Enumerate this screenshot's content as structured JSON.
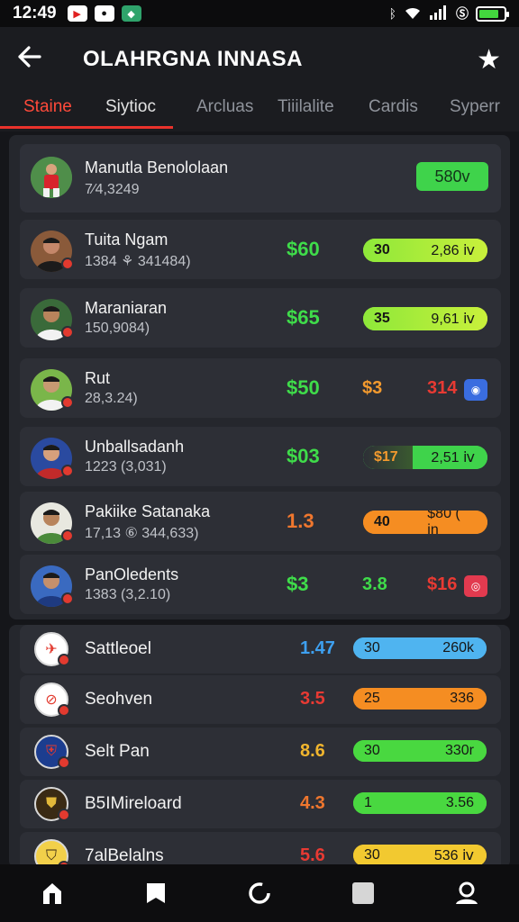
{
  "status_bar": {
    "time": "12:49",
    "apps": [
      "youtube-icon",
      "chat-icon",
      "gallery-icon"
    ],
    "battery_level": 0.8,
    "icons": [
      "bluetooth-icon",
      "wifi-icon",
      "signal-icon",
      "nfc-icon",
      "battery-icon"
    ]
  },
  "header": {
    "title": "OLAHRGNA INNASA",
    "back_icon": "back-arrow-icon",
    "favorite_icon": "star-icon"
  },
  "tabs": [
    {
      "label": "Staine",
      "active": true
    },
    {
      "label": "Siytioc",
      "active": false
    },
    {
      "label": "Arcluas",
      "active": false
    },
    {
      "label": "Tiiilalite",
      "active": false
    },
    {
      "label": "Cardis",
      "active": false
    },
    {
      "label": "Syperr",
      "active": false
    }
  ],
  "featured": {
    "name": "Manutla Benololaan",
    "stats": "7⁄4,3249",
    "button": "580v",
    "button_color": "#3fd34b"
  },
  "players": [
    {
      "name": "Tuita Ngam",
      "stats": "1384 ⚘ 341484)",
      "price": "$60",
      "price_color": "#3fdc4a",
      "pill_left": "30",
      "pill_right": "2,86 ⅳ",
      "pill_fill": 1.0,
      "pill_colors": [
        "#8ee83a",
        "#c9f03b"
      ]
    },
    {
      "name": "Maraniaran",
      "stats": "150,9084)",
      "price": "$65",
      "price_color": "#3fdc4a",
      "pill_left": "35",
      "pill_right": "9,61 ⅳ",
      "pill_fill": 1.0,
      "pill_colors": [
        "#8ee83a",
        "#c9f03b"
      ]
    },
    {
      "name": "Rut",
      "stats": "28,3.24)",
      "price": "$50",
      "price_color": "#3fdc4a",
      "plain_value": "$3",
      "plain_color": "#f39a2e",
      "plain_red": "314",
      "icon": "info-icon",
      "icon_color": "#3a6de0"
    },
    {
      "name": "Unballsadanh",
      "stats": "1223 (3,031)",
      "price": "$03",
      "price_color": "#3fdc4a",
      "pill_left": "$17",
      "pill_right": "2,51 ⅳ",
      "pill_fill": 1.0,
      "pill_colors": [
        "#3fd34b",
        "#3fd34b"
      ],
      "pill_left_color": "#f39a2e"
    },
    {
      "name": "Pakiike Satanaka",
      "stats": "17,13 ⑥ 344,633)",
      "price": "1.3",
      "price_color": "#f0772e",
      "pill_left": "40",
      "pill_right": "$80 ( in",
      "pill_fill": 1.0,
      "pill_colors": [
        "#f58d22",
        "#f58d22"
      ]
    },
    {
      "name": "PanOledents",
      "stats": "1383 (3,2.10)",
      "price": "$3",
      "price_color": "#3fdc4a",
      "plain_value": "3.8",
      "plain_color": "#3fdc4a",
      "plain_red": "$16",
      "icon": "alert-icon",
      "icon_color": "#e23a4f"
    }
  ],
  "teams": [
    {
      "name": "Sattleoel",
      "price": "1.47",
      "price_color": "#3ea0f0",
      "pill_left": "30",
      "pill_right": "260k",
      "pill_fill": 1.0,
      "pill_color": "#4fb4f0",
      "crest_bg": "#ffffff",
      "crest_fg": "#e23a2f",
      "crest_glyph": "✈"
    },
    {
      "name": "Seohven",
      "price": "3.5",
      "price_color": "#e83a33",
      "pill_left": "25",
      "pill_right": "336",
      "pill_fill": 1.0,
      "pill_color": "#f58d22",
      "crest_bg": "#ffffff",
      "crest_fg": "#e23a2f",
      "crest_glyph": "⊘"
    },
    {
      "name": "Selt Pan",
      "price": "8.6",
      "price_color": "#f0b52e",
      "pill_left": "30",
      "pill_right": "330r",
      "pill_fill": 1.0,
      "pill_color": "#49d840",
      "crest_bg": "#1c3d8f",
      "crest_fg": "#e23a2f",
      "crest_glyph": "⛨"
    },
    {
      "name": "B5IMireloard",
      "price": "4.3",
      "price_color": "#f0772e",
      "pill_left": "1",
      "pill_right": "3.56",
      "pill_fill": 1.0,
      "pill_color": "#49d840",
      "crest_bg": "#3a2a14",
      "crest_fg": "#e2b83a",
      "crest_glyph": "⛊"
    },
    {
      "name": "7alBelalns",
      "price": "5.6",
      "price_color": "#e83a33",
      "pill_left": "30",
      "pill_right": "536 ⅳ",
      "pill_fill": 1.0,
      "pill_color": "#f2c930",
      "crest_bg": "#f2d04a",
      "crest_fg": "#3a2a14",
      "crest_glyph": "⛉"
    }
  ],
  "bottom_nav": [
    {
      "icon": "home-icon",
      "active": true
    },
    {
      "icon": "bookmark-icon",
      "active": false
    },
    {
      "icon": "refresh-icon",
      "active": false
    },
    {
      "icon": "square-icon",
      "active": false
    },
    {
      "icon": "profile-icon",
      "active": false
    }
  ]
}
